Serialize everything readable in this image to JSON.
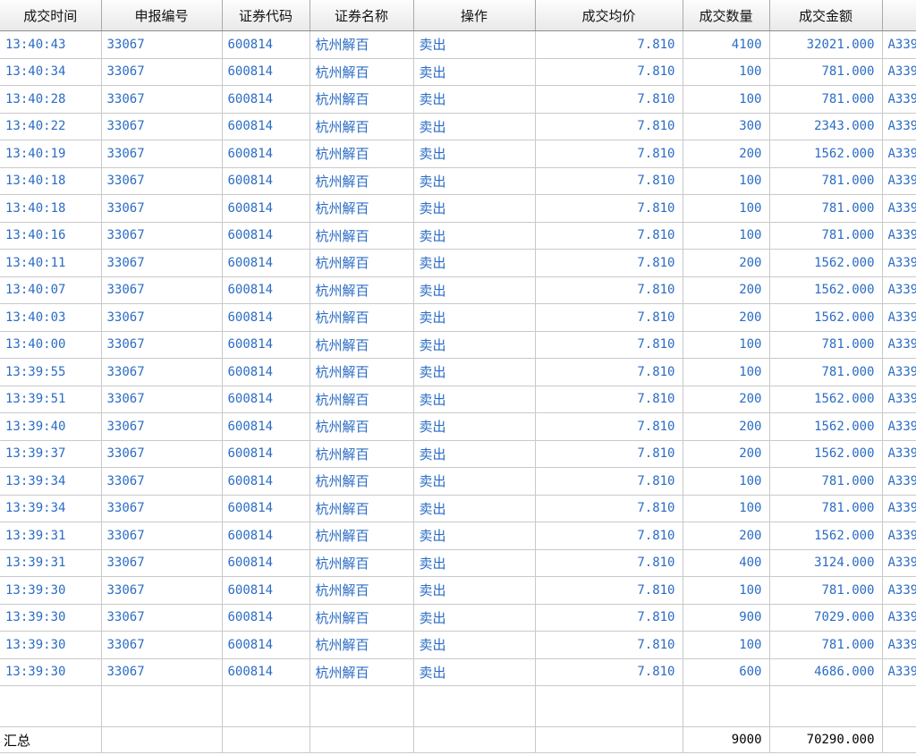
{
  "table": {
    "columns": [
      "成交时间",
      "申报编号",
      "证券代码",
      "证券名称",
      "操作",
      "成交均价",
      "成交数量",
      "成交金额",
      ""
    ],
    "rows": [
      [
        "13:40:43",
        "33067",
        "600814",
        "杭州解百",
        "卖出",
        "7.810",
        "4100",
        "32021.000",
        "A339"
      ],
      [
        "13:40:34",
        "33067",
        "600814",
        "杭州解百",
        "卖出",
        "7.810",
        "100",
        "781.000",
        "A339"
      ],
      [
        "13:40:28",
        "33067",
        "600814",
        "杭州解百",
        "卖出",
        "7.810",
        "100",
        "781.000",
        "A339"
      ],
      [
        "13:40:22",
        "33067",
        "600814",
        "杭州解百",
        "卖出",
        "7.810",
        "300",
        "2343.000",
        "A339"
      ],
      [
        "13:40:19",
        "33067",
        "600814",
        "杭州解百",
        "卖出",
        "7.810",
        "200",
        "1562.000",
        "A339"
      ],
      [
        "13:40:18",
        "33067",
        "600814",
        "杭州解百",
        "卖出",
        "7.810",
        "100",
        "781.000",
        "A339"
      ],
      [
        "13:40:18",
        "33067",
        "600814",
        "杭州解百",
        "卖出",
        "7.810",
        "100",
        "781.000",
        "A339"
      ],
      [
        "13:40:16",
        "33067",
        "600814",
        "杭州解百",
        "卖出",
        "7.810",
        "100",
        "781.000",
        "A339"
      ],
      [
        "13:40:11",
        "33067",
        "600814",
        "杭州解百",
        "卖出",
        "7.810",
        "200",
        "1562.000",
        "A339"
      ],
      [
        "13:40:07",
        "33067",
        "600814",
        "杭州解百",
        "卖出",
        "7.810",
        "200",
        "1562.000",
        "A339"
      ],
      [
        "13:40:03",
        "33067",
        "600814",
        "杭州解百",
        "卖出",
        "7.810",
        "200",
        "1562.000",
        "A339"
      ],
      [
        "13:40:00",
        "33067",
        "600814",
        "杭州解百",
        "卖出",
        "7.810",
        "100",
        "781.000",
        "A339"
      ],
      [
        "13:39:55",
        "33067",
        "600814",
        "杭州解百",
        "卖出",
        "7.810",
        "100",
        "781.000",
        "A339"
      ],
      [
        "13:39:51",
        "33067",
        "600814",
        "杭州解百",
        "卖出",
        "7.810",
        "200",
        "1562.000",
        "A339"
      ],
      [
        "13:39:40",
        "33067",
        "600814",
        "杭州解百",
        "卖出",
        "7.810",
        "200",
        "1562.000",
        "A339"
      ],
      [
        "13:39:37",
        "33067",
        "600814",
        "杭州解百",
        "卖出",
        "7.810",
        "200",
        "1562.000",
        "A339"
      ],
      [
        "13:39:34",
        "33067",
        "600814",
        "杭州解百",
        "卖出",
        "7.810",
        "100",
        "781.000",
        "A339"
      ],
      [
        "13:39:34",
        "33067",
        "600814",
        "杭州解百",
        "卖出",
        "7.810",
        "100",
        "781.000",
        "A339"
      ],
      [
        "13:39:31",
        "33067",
        "600814",
        "杭州解百",
        "卖出",
        "7.810",
        "200",
        "1562.000",
        "A339"
      ],
      [
        "13:39:31",
        "33067",
        "600814",
        "杭州解百",
        "卖出",
        "7.810",
        "400",
        "3124.000",
        "A339"
      ],
      [
        "13:39:30",
        "33067",
        "600814",
        "杭州解百",
        "卖出",
        "7.810",
        "100",
        "781.000",
        "A339"
      ],
      [
        "13:39:30",
        "33067",
        "600814",
        "杭州解百",
        "卖出",
        "7.810",
        "900",
        "7029.000",
        "A339"
      ],
      [
        "13:39:30",
        "33067",
        "600814",
        "杭州解百",
        "卖出",
        "7.810",
        "100",
        "781.000",
        "A339"
      ],
      [
        "13:39:30",
        "33067",
        "600814",
        "杭州解百",
        "卖出",
        "7.810",
        "600",
        "4686.000",
        "A339"
      ]
    ],
    "summary": {
      "label": "汇总",
      "total_quantity": "9000",
      "total_amount": "70290.000"
    }
  },
  "colors": {
    "row_text": "#2b6cc4",
    "grid_line": "#c9c9c9",
    "header_bg": "#eeeeee"
  }
}
